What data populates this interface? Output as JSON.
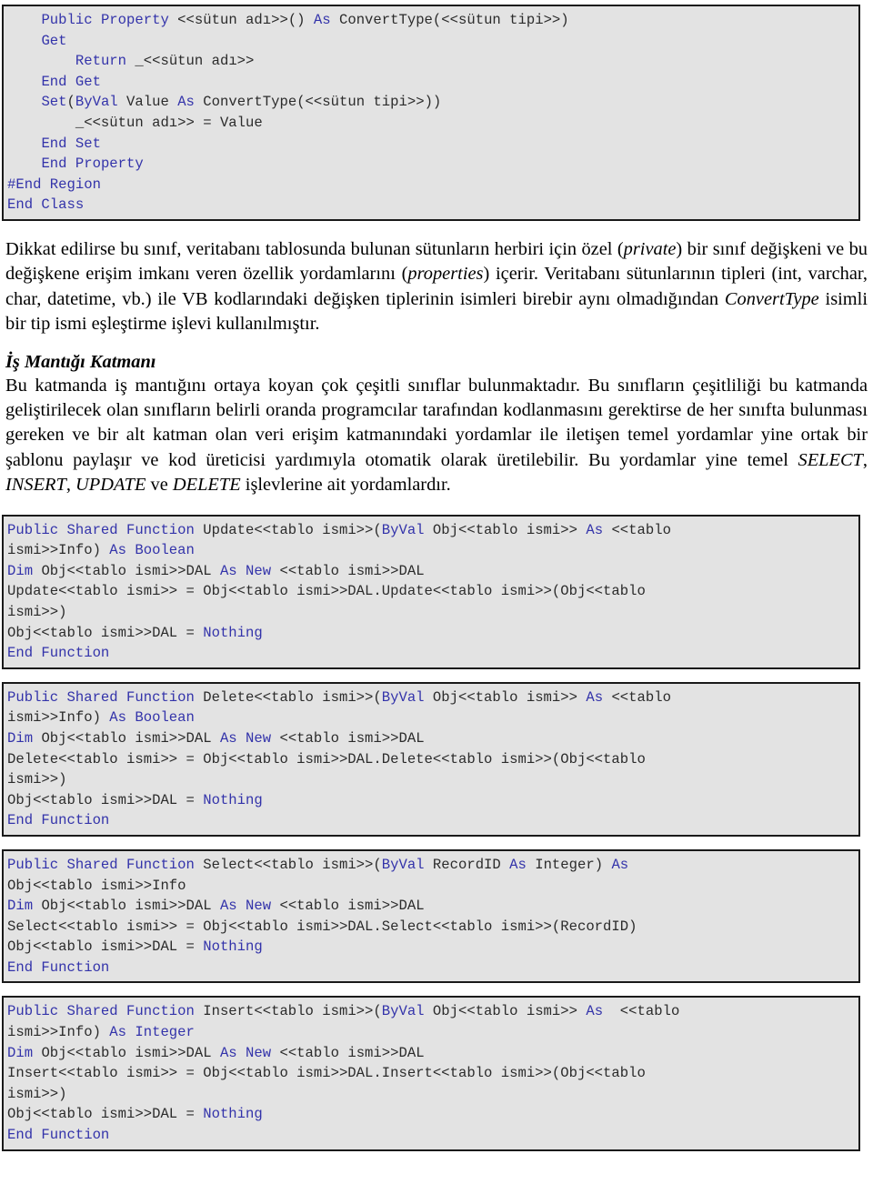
{
  "document": {
    "language": "tr",
    "colors": {
      "code_background": "#e3e3e3",
      "code_border": "#1a1a1a",
      "code_keyword": "#3333aa",
      "code_text": "#2b2b2b",
      "body_text": "#000000",
      "page_background": "#ffffff"
    }
  },
  "code_blocks": [
    {
      "id": "property-block",
      "lines": [
        [
          {
            "t": "    ",
            "k": false
          },
          {
            "t": "Public Property ",
            "k": true
          },
          {
            "t": "<<sütun adı>>() ",
            "k": false
          },
          {
            "t": "As ",
            "k": true
          },
          {
            "t": "ConvertType(<<sütun tipi>>)",
            "k": false
          }
        ],
        [
          {
            "t": "    ",
            "k": false
          },
          {
            "t": "Get",
            "k": true
          }
        ],
        [
          {
            "t": "        ",
            "k": false
          },
          {
            "t": "Return ",
            "k": true
          },
          {
            "t": "_<<sütun adı>>",
            "k": false
          }
        ],
        [
          {
            "t": "    ",
            "k": false
          },
          {
            "t": "End Get",
            "k": true
          }
        ],
        [
          {
            "t": "    ",
            "k": false
          },
          {
            "t": "Set",
            "k": true
          },
          {
            "t": "(",
            "k": false
          },
          {
            "t": "ByVal ",
            "k": true
          },
          {
            "t": "Value ",
            "k": false
          },
          {
            "t": "As ",
            "k": true
          },
          {
            "t": "ConvertType(<<sütun tipi>>))",
            "k": false
          }
        ],
        [
          {
            "t": "        _<<sütun adı>> = Value",
            "k": false
          }
        ],
        [
          {
            "t": "    ",
            "k": false
          },
          {
            "t": "End Set",
            "k": true
          }
        ],
        [
          {
            "t": "    ",
            "k": false
          },
          {
            "t": "End Property",
            "k": true
          }
        ],
        [
          {
            "t": "#End Region",
            "k": true
          }
        ],
        [
          {
            "t": "End Class",
            "k": true
          }
        ]
      ]
    },
    {
      "id": "update-function-block",
      "lines": [
        [
          {
            "t": "Public Shared Function ",
            "k": true
          },
          {
            "t": "Update<<tablo ismi>>(",
            "k": false
          },
          {
            "t": "ByVal ",
            "k": true
          },
          {
            "t": "Obj<<tablo ismi>> ",
            "k": false
          },
          {
            "t": "As ",
            "k": true
          },
          {
            "t": "<<tablo",
            "k": false
          }
        ],
        [
          {
            "t": "ismi>>Info) ",
            "k": false
          },
          {
            "t": "As Boolean",
            "k": true
          }
        ],
        [
          {
            "t": "Dim ",
            "k": true
          },
          {
            "t": "Obj<<tablo ismi>>DAL ",
            "k": false
          },
          {
            "t": "As New ",
            "k": true
          },
          {
            "t": "<<tablo ismi>>DAL",
            "k": false
          }
        ],
        [
          {
            "t": "Update<<tablo ismi>> = Obj<<tablo ismi>>DAL.Update<<tablo ismi>>(Obj<<tablo",
            "k": false
          }
        ],
        [
          {
            "t": "ismi>>)",
            "k": false
          }
        ],
        [
          {
            "t": "Obj<<tablo ismi>>DAL = ",
            "k": false
          },
          {
            "t": "Nothing",
            "k": true
          }
        ],
        [
          {
            "t": "End Function",
            "k": true
          }
        ]
      ]
    },
    {
      "id": "delete-function-block",
      "lines": [
        [
          {
            "t": "Public Shared Function ",
            "k": true
          },
          {
            "t": "Delete<<tablo ismi>>(",
            "k": false
          },
          {
            "t": "ByVal ",
            "k": true
          },
          {
            "t": "Obj<<tablo ismi>> ",
            "k": false
          },
          {
            "t": "As ",
            "k": true
          },
          {
            "t": "<<tablo",
            "k": false
          }
        ],
        [
          {
            "t": "ismi>>Info) ",
            "k": false
          },
          {
            "t": "As Boolean",
            "k": true
          }
        ],
        [
          {
            "t": "Dim ",
            "k": true
          },
          {
            "t": "Obj<<tablo ismi>>DAL ",
            "k": false
          },
          {
            "t": "As New ",
            "k": true
          },
          {
            "t": "<<tablo ismi>>DAL",
            "k": false
          }
        ],
        [
          {
            "t": "Delete<<tablo ismi>> = Obj<<tablo ismi>>DAL.Delete<<tablo ismi>>(Obj<<tablo",
            "k": false
          }
        ],
        [
          {
            "t": "ismi>>)",
            "k": false
          }
        ],
        [
          {
            "t": "Obj<<tablo ismi>>DAL = ",
            "k": false
          },
          {
            "t": "Nothing",
            "k": true
          }
        ],
        [
          {
            "t": "End Function",
            "k": true
          }
        ]
      ]
    },
    {
      "id": "select-function-block",
      "lines": [
        [
          {
            "t": "Public Shared Function ",
            "k": true
          },
          {
            "t": "Select<<tablo ismi>>(",
            "k": false
          },
          {
            "t": "ByVal ",
            "k": true
          },
          {
            "t": "RecordID ",
            "k": false
          },
          {
            "t": "As ",
            "k": true
          },
          {
            "t": "Integer) ",
            "k": false
          },
          {
            "t": "As",
            "k": true
          }
        ],
        [
          {
            "t": "Obj<<tablo ismi>>Info",
            "k": false
          }
        ],
        [
          {
            "t": "Dim ",
            "k": true
          },
          {
            "t": "Obj<<tablo ismi>>DAL ",
            "k": false
          },
          {
            "t": "As New ",
            "k": true
          },
          {
            "t": "<<tablo ismi>>DAL",
            "k": false
          }
        ],
        [
          {
            "t": "Select<<tablo ismi>> = Obj<<tablo ismi>>DAL.Select<<tablo ismi>>(RecordID)",
            "k": false
          }
        ],
        [
          {
            "t": "Obj<<tablo ismi>>DAL = ",
            "k": false
          },
          {
            "t": "Nothing",
            "k": true
          }
        ],
        [
          {
            "t": "End Function",
            "k": true
          }
        ]
      ]
    },
    {
      "id": "insert-function-block",
      "lines": [
        [
          {
            "t": "Public Shared Function ",
            "k": true
          },
          {
            "t": "Insert<<tablo ismi>>(",
            "k": false
          },
          {
            "t": "ByVal ",
            "k": true
          },
          {
            "t": "Obj<<tablo ismi>> ",
            "k": false
          },
          {
            "t": "As ",
            "k": true
          },
          {
            "t": " <<tablo",
            "k": false
          }
        ],
        [
          {
            "t": "ismi>>Info) ",
            "k": false
          },
          {
            "t": "As Integer",
            "k": true
          }
        ],
        [
          {
            "t": "Dim ",
            "k": true
          },
          {
            "t": "Obj<<tablo ismi>>DAL ",
            "k": false
          },
          {
            "t": "As New ",
            "k": true
          },
          {
            "t": "<<tablo ismi>>DAL",
            "k": false
          }
        ],
        [
          {
            "t": "Insert<<tablo ismi>> = Obj<<tablo ismi>>DAL.Insert<<tablo ismi>>(Obj<<tablo",
            "k": false
          }
        ],
        [
          {
            "t": "ismi>>)",
            "k": false
          }
        ],
        [
          {
            "t": "Obj<<tablo ismi>>DAL = ",
            "k": false
          },
          {
            "t": "Nothing",
            "k": true
          }
        ],
        [
          {
            "t": "End Function",
            "k": true
          }
        ]
      ]
    }
  ],
  "paragraphs": {
    "p1": [
      {
        "t": "Dikkat edilirse bu sınıf, veritabanı tablosunda bulunan sütunların herbiri için özel (",
        "i": false
      },
      {
        "t": "private",
        "i": true
      },
      {
        "t": ") bir sınıf değişkeni ve bu değişkene erişim imkanı veren özellik yordamlarını (",
        "i": false
      },
      {
        "t": "properties",
        "i": true
      },
      {
        "t": ") içerir. Veritabanı sütunlarının tipleri (int, varchar, char, datetime, vb.) ile VB kodlarındaki değişken tiplerinin isimleri birebir aynı olmadığından ",
        "i": false
      },
      {
        "t": "ConvertType",
        "i": true
      },
      {
        "t": " isimli bir tip ismi eşleştirme işlevi kullanılmıştır.",
        "i": false
      }
    ],
    "heading_is_mantigi": "İş Mantığı Katmanı",
    "p2": [
      {
        "t": "Bu katmanda iş mantığını ortaya koyan çok çeşitli sınıflar bulunmaktadır. Bu sınıfların çeşitliliği bu katmanda geliştirilecek olan sınıfların belirli oranda programcılar tarafından kodlanmasını gerektirse de her sınıfta bulunması gereken ve bir alt katman olan veri erişim katmanındaki yordamlar ile iletişen temel yordamlar yine ortak bir şablonu paylaşır ve kod üreticisi yardımıyla otomatik olarak üretilebilir. Bu yordamlar yine temel ",
        "i": false
      },
      {
        "t": "SELECT",
        "i": true
      },
      {
        "t": ", ",
        "i": false
      },
      {
        "t": "INSERT",
        "i": true
      },
      {
        "t": ", ",
        "i": false
      },
      {
        "t": "UPDATE",
        "i": true
      },
      {
        "t": " ve ",
        "i": false
      },
      {
        "t": "DELETE",
        "i": true
      },
      {
        "t": " işlevlerine ait yordamlardır.",
        "i": false
      }
    ]
  }
}
